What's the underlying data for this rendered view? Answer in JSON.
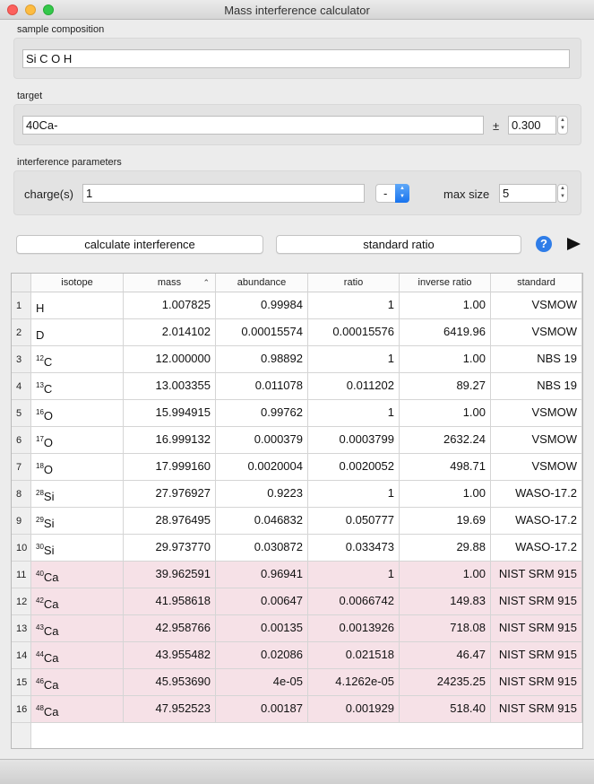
{
  "window": {
    "title": "Mass interference calculator"
  },
  "sample": {
    "label": "sample composition",
    "value": "Si C O H"
  },
  "target": {
    "label": "target",
    "value": "40Ca-",
    "pm": "±",
    "tolerance": "0.300"
  },
  "params": {
    "label": "interference parameters",
    "charge_label": "charge(s)",
    "charge_value": "1",
    "sign_value": "-",
    "max_size_label": "max size",
    "max_size_value": "5"
  },
  "buttons": {
    "calculate": "calculate interference",
    "standard": "standard ratio",
    "help": "?"
  },
  "table": {
    "columns": [
      "isotope",
      "mass",
      "abundance",
      "ratio",
      "inverse ratio",
      "standard"
    ],
    "sorted_by": "mass",
    "highlight_color": "#f6e1e7",
    "rows": [
      {
        "num": "1",
        "iso_sup": "",
        "iso_el": "H",
        "mass": "1.007825",
        "abundance": "0.99984",
        "ratio": "1",
        "inverse": "1.00",
        "standard": "VSMOW",
        "highlight": false
      },
      {
        "num": "2",
        "iso_sup": "",
        "iso_el": "D",
        "mass": "2.014102",
        "abundance": "0.00015574",
        "ratio": "0.00015576",
        "inverse": "6419.96",
        "standard": "VSMOW",
        "highlight": false
      },
      {
        "num": "3",
        "iso_sup": "12",
        "iso_el": "C",
        "mass": "12.000000",
        "abundance": "0.98892",
        "ratio": "1",
        "inverse": "1.00",
        "standard": "NBS 19",
        "highlight": false
      },
      {
        "num": "4",
        "iso_sup": "13",
        "iso_el": "C",
        "mass": "13.003355",
        "abundance": "0.011078",
        "ratio": "0.011202",
        "inverse": "89.27",
        "standard": "NBS 19",
        "highlight": false
      },
      {
        "num": "5",
        "iso_sup": "16",
        "iso_el": "O",
        "mass": "15.994915",
        "abundance": "0.99762",
        "ratio": "1",
        "inverse": "1.00",
        "standard": "VSMOW",
        "highlight": false
      },
      {
        "num": "6",
        "iso_sup": "17",
        "iso_el": "O",
        "mass": "16.999132",
        "abundance": "0.000379",
        "ratio": "0.0003799",
        "inverse": "2632.24",
        "standard": "VSMOW",
        "highlight": false
      },
      {
        "num": "7",
        "iso_sup": "18",
        "iso_el": "O",
        "mass": "17.999160",
        "abundance": "0.0020004",
        "ratio": "0.0020052",
        "inverse": "498.71",
        "standard": "VSMOW",
        "highlight": false
      },
      {
        "num": "8",
        "iso_sup": "28",
        "iso_el": "Si",
        "mass": "27.976927",
        "abundance": "0.9223",
        "ratio": "1",
        "inverse": "1.00",
        "standard": "WASO-17.2",
        "highlight": false
      },
      {
        "num": "9",
        "iso_sup": "29",
        "iso_el": "Si",
        "mass": "28.976495",
        "abundance": "0.046832",
        "ratio": "0.050777",
        "inverse": "19.69",
        "standard": "WASO-17.2",
        "highlight": false
      },
      {
        "num": "10",
        "iso_sup": "30",
        "iso_el": "Si",
        "mass": "29.973770",
        "abundance": "0.030872",
        "ratio": "0.033473",
        "inverse": "29.88",
        "standard": "WASO-17.2",
        "highlight": false
      },
      {
        "num": "11",
        "iso_sup": "40",
        "iso_el": "Ca",
        "mass": "39.962591",
        "abundance": "0.96941",
        "ratio": "1",
        "inverse": "1.00",
        "standard": "NIST SRM 915",
        "highlight": true
      },
      {
        "num": "12",
        "iso_sup": "42",
        "iso_el": "Ca",
        "mass": "41.958618",
        "abundance": "0.00647",
        "ratio": "0.0066742",
        "inverse": "149.83",
        "standard": "NIST SRM 915",
        "highlight": true
      },
      {
        "num": "13",
        "iso_sup": "43",
        "iso_el": "Ca",
        "mass": "42.958766",
        "abundance": "0.00135",
        "ratio": "0.0013926",
        "inverse": "718.08",
        "standard": "NIST SRM 915",
        "highlight": true
      },
      {
        "num": "14",
        "iso_sup": "44",
        "iso_el": "Ca",
        "mass": "43.955482",
        "abundance": "0.02086",
        "ratio": "0.021518",
        "inverse": "46.47",
        "standard": "NIST SRM 915",
        "highlight": true
      },
      {
        "num": "15",
        "iso_sup": "46",
        "iso_el": "Ca",
        "mass": "45.953690",
        "abundance": "4e-05",
        "ratio": "4.1262e-05",
        "inverse": "24235.25",
        "standard": "NIST SRM 915",
        "highlight": true
      },
      {
        "num": "16",
        "iso_sup": "48",
        "iso_el": "Ca",
        "mass": "47.952523",
        "abundance": "0.00187",
        "ratio": "0.001929",
        "inverse": "518.40",
        "standard": "NIST SRM 915",
        "highlight": true
      }
    ]
  }
}
